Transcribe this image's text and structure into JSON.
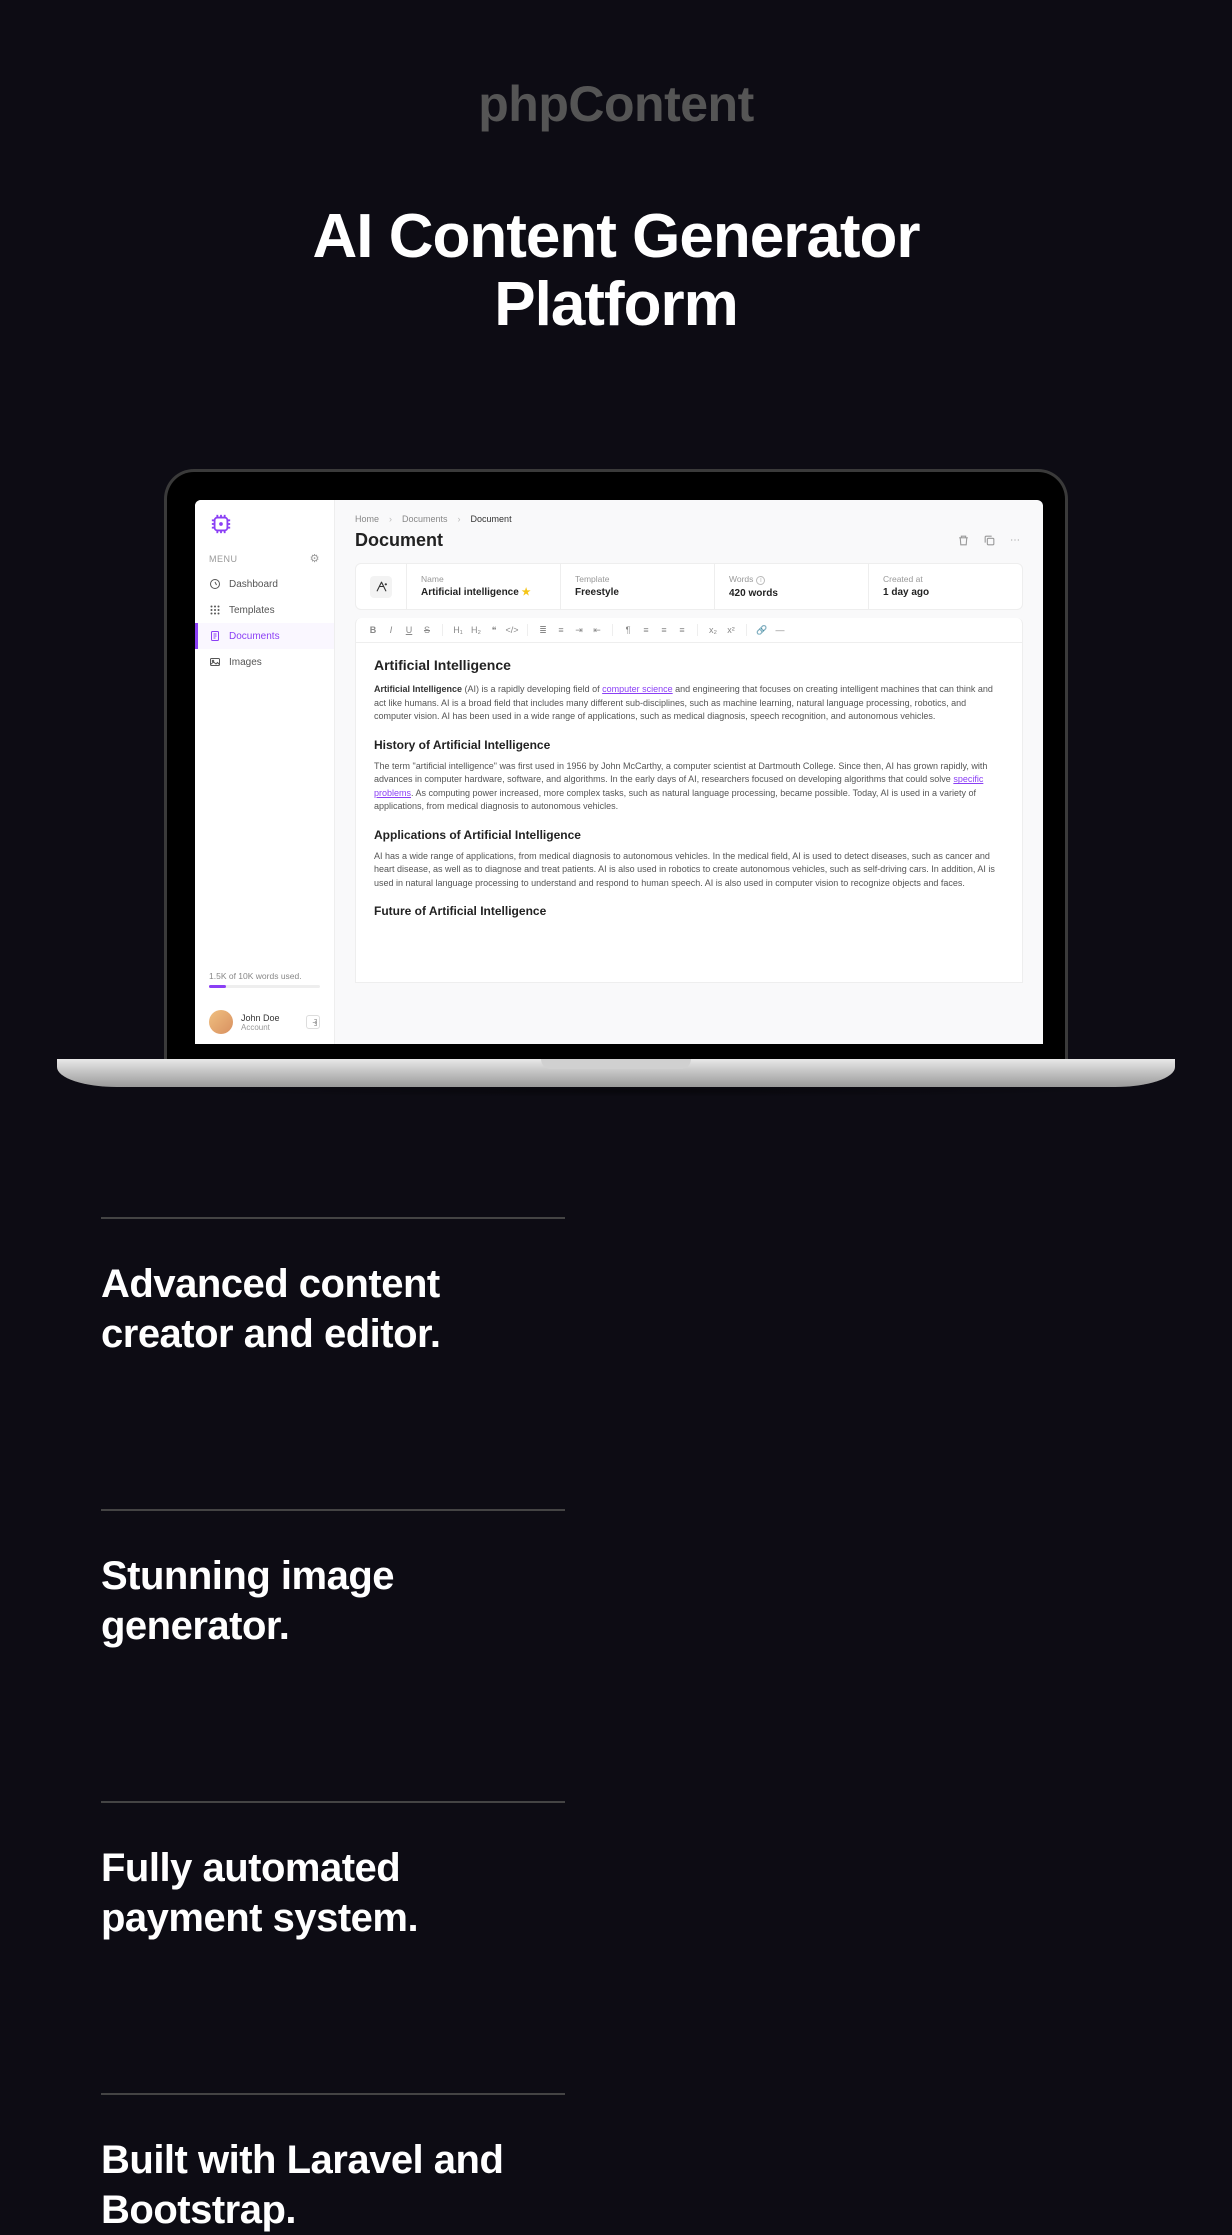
{
  "brand": "phpContent",
  "headline_line1": "AI Content Generator",
  "headline_line2": "Platform",
  "sidebar": {
    "menu_label": "MENU",
    "items": [
      {
        "label": "Dashboard",
        "icon": "dashboard-icon"
      },
      {
        "label": "Templates",
        "icon": "grid-icon"
      },
      {
        "label": "Documents",
        "icon": "document-icon",
        "active": true
      },
      {
        "label": "Images",
        "icon": "image-icon"
      }
    ],
    "usage_text": "1.5K of 10K words used.",
    "user_name": "John Doe",
    "user_sub": "Account"
  },
  "breadcrumb": [
    "Home",
    "Documents",
    "Document"
  ],
  "page_title": "Document",
  "meta": {
    "name_label": "Name",
    "name_value": "Artificial intelligence",
    "template_label": "Template",
    "template_value": "Freestyle",
    "words_label": "Words",
    "words_value": "420 words",
    "created_label": "Created at",
    "created_value": "1 day ago"
  },
  "article": {
    "h1": "Artificial Intelligence",
    "p1_strong": "Artificial Intelligence",
    "p1_a": " (AI) is a rapidly developing field of ",
    "p1_link": "computer science",
    "p1_b": " and engineering that focuses on creating intelligent machines that can think and act like humans. AI is a broad field that includes many different sub-disciplines, such as machine learning, natural language processing, robotics, and computer vision. AI has been used in a wide range of applications, such as medical diagnosis, speech recognition, and autonomous vehicles.",
    "h2": "History of Artificial Intelligence",
    "p2_a": "The term \"artificial intelligence\" was first used in 1956 by John McCarthy, a computer scientist at Dartmouth College. Since then, AI has grown rapidly, with advances in computer hardware, software, and algorithms. In the early days of AI, researchers focused on developing algorithms that could solve ",
    "p2_link": "specific problems",
    "p2_b": ". As computing power increased, more complex tasks, such as natural language processing, became possible. Today, AI is used in a variety of applications, from medical diagnosis to autonomous vehicles.",
    "h3": "Applications of Artificial Intelligence",
    "p3": "AI has a wide range of applications, from medical diagnosis to autonomous vehicles. In the medical field, AI is used to detect diseases, such as cancer and heart disease, as well as to diagnose and treat patients. AI is also used in robotics to create autonomous vehicles, such as self-driving cars. In addition, AI is used in natural language processing to understand and respond to human speech. AI is also used in computer vision to recognize objects and faces.",
    "h4": "Future of Artificial Intelligence"
  },
  "features": [
    "Advanced content creator and editor.",
    "Stunning image generator.",
    "Fully automated payment system.",
    "Built with Laravel and Bootstrap."
  ]
}
